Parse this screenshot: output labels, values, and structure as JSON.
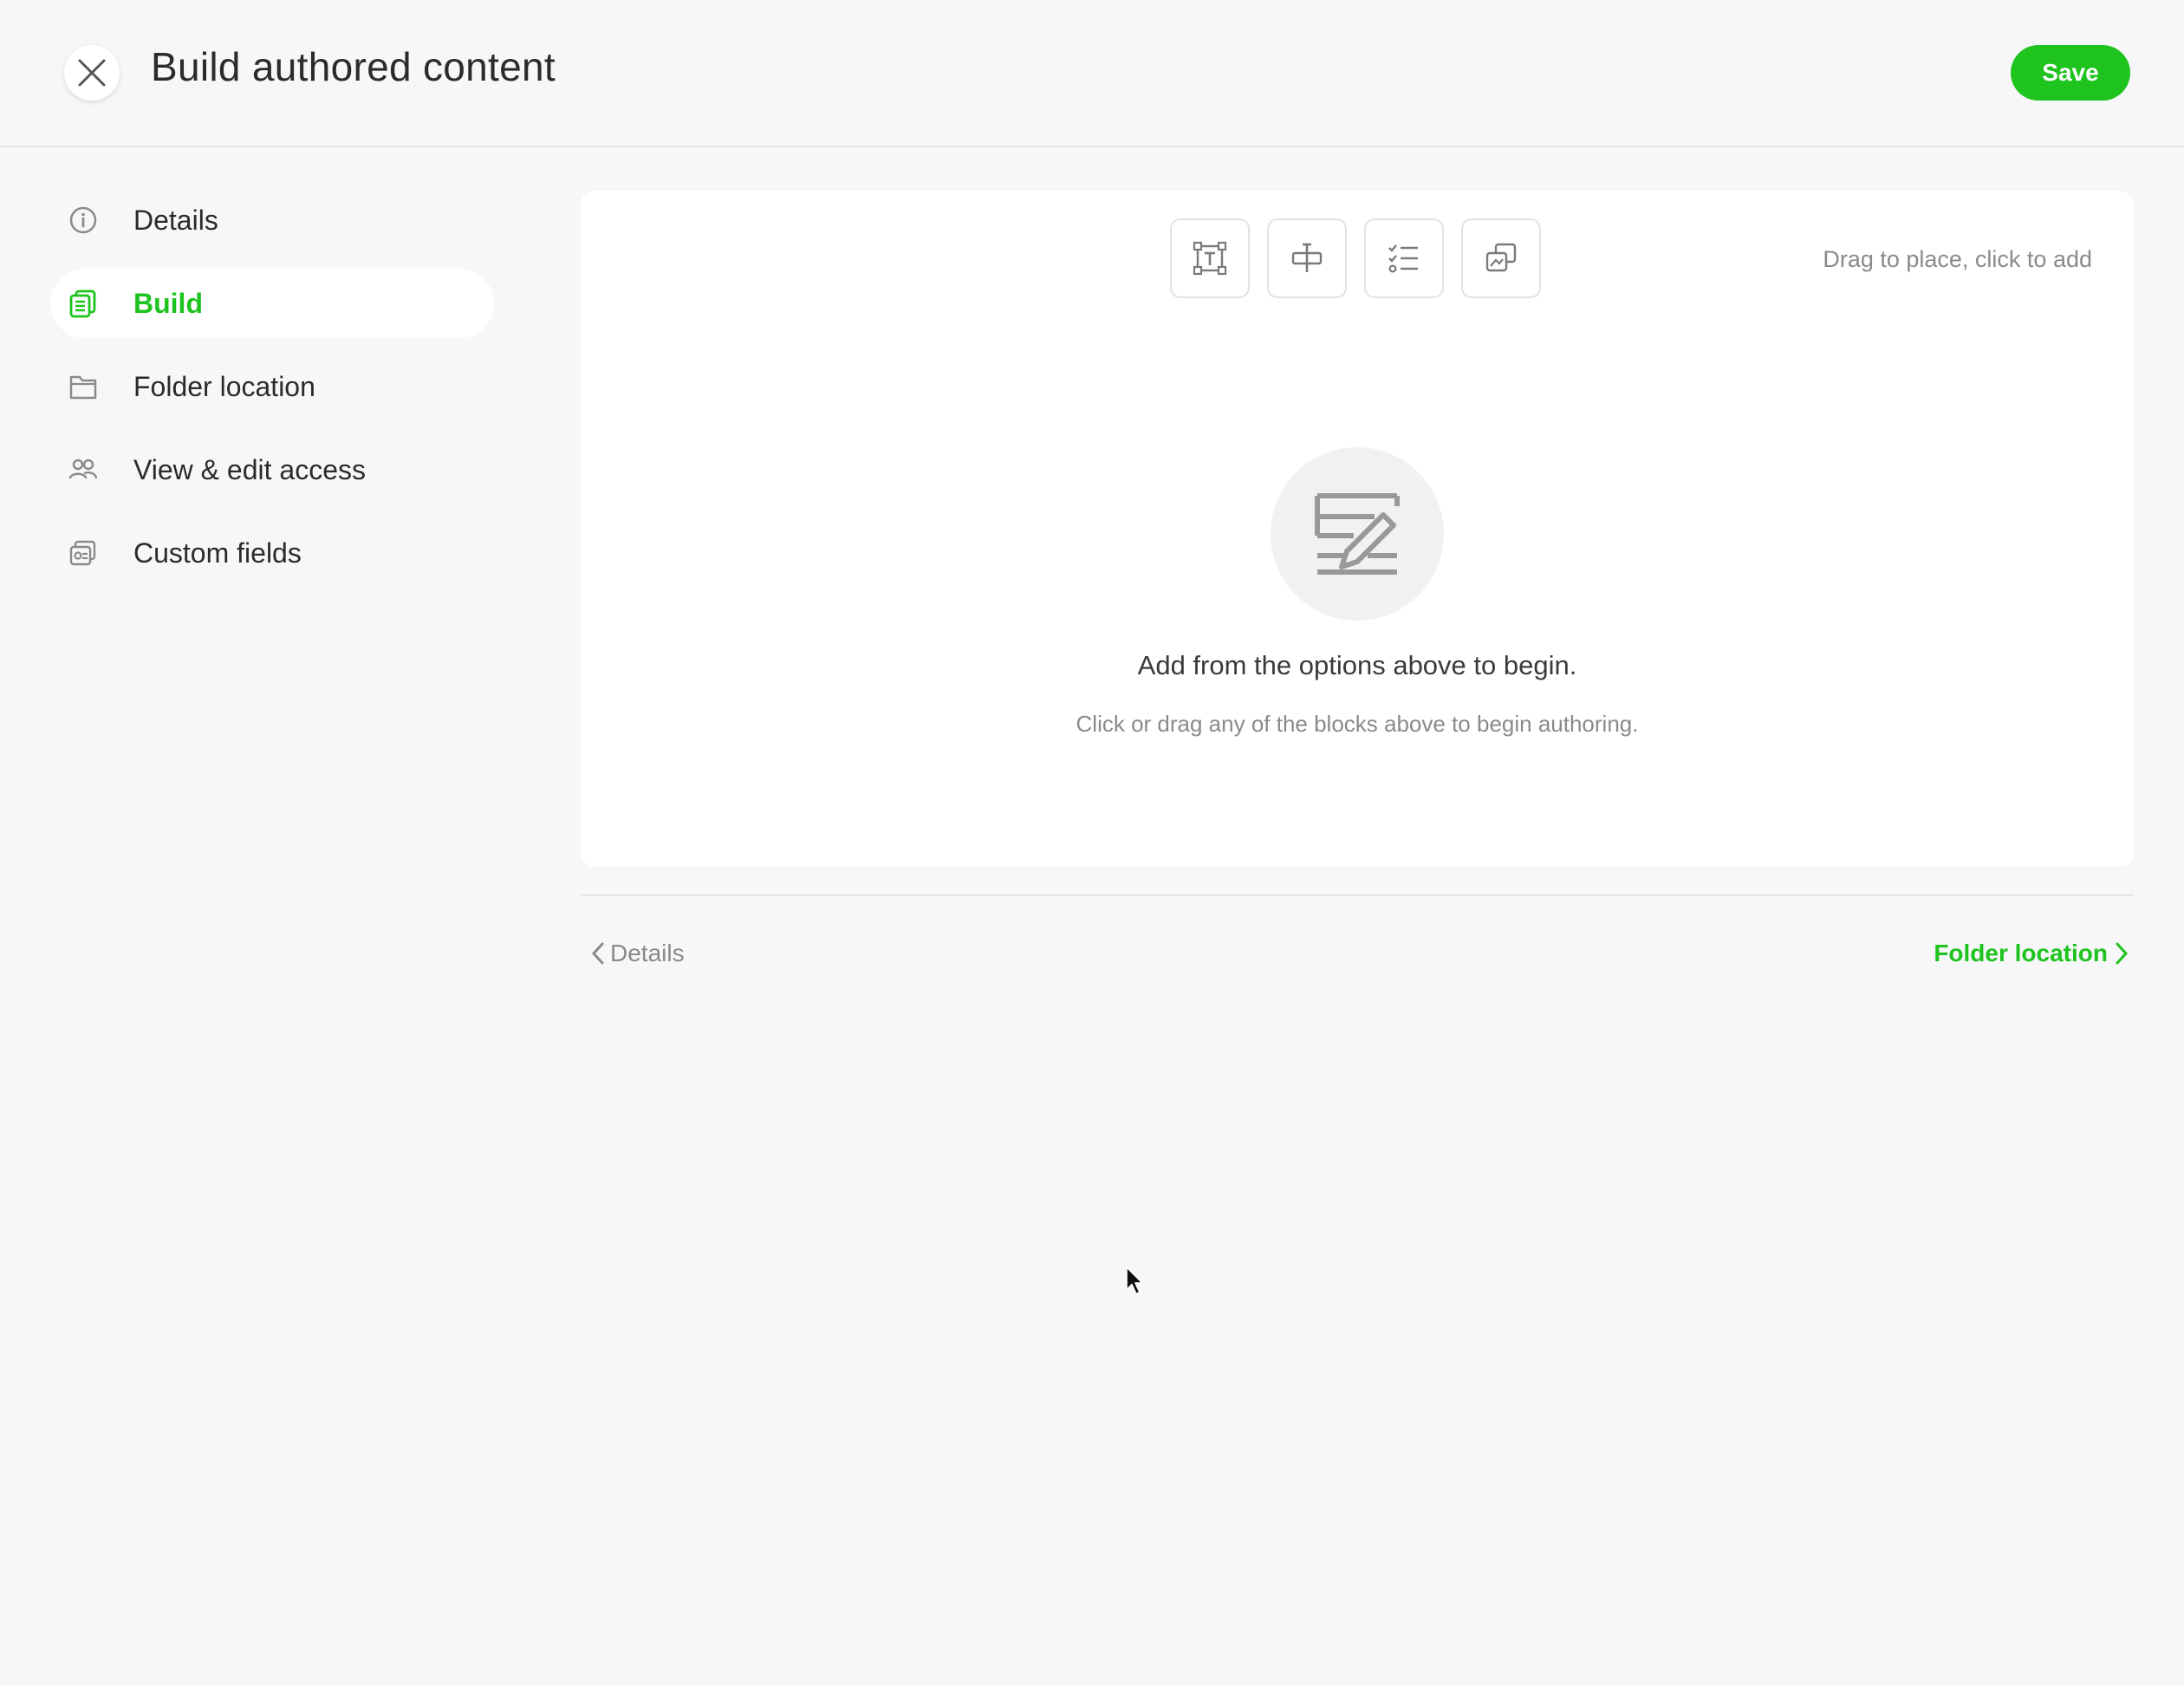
{
  "header": {
    "title": "Build authored content",
    "save_label": "Save"
  },
  "sidebar": {
    "items": [
      {
        "label": "Details",
        "icon": "info-icon",
        "active": false
      },
      {
        "label": "Build",
        "icon": "build-pages-icon",
        "active": true
      },
      {
        "label": "Folder location",
        "icon": "folder-icon",
        "active": false
      },
      {
        "label": "View & edit access",
        "icon": "people-icon",
        "active": false
      },
      {
        "label": "Custom fields",
        "icon": "custom-fields-icon",
        "active": false
      }
    ]
  },
  "toolbar": {
    "tools": [
      "text-block-icon",
      "divider-block-icon",
      "list-block-icon",
      "media-block-icon"
    ],
    "hint": "Drag to place, click to add"
  },
  "empty_state": {
    "icon": "authoring-icon",
    "title": "Add from the options above to begin.",
    "subtitle": "Click or drag any of the blocks above to begin authoring."
  },
  "footer_nav": {
    "prev_label": "Details",
    "next_label": "Folder location"
  },
  "colors": {
    "accent": "#1ec31e",
    "background": "#f7f7f9",
    "muted_text": "#8a8a8a"
  }
}
